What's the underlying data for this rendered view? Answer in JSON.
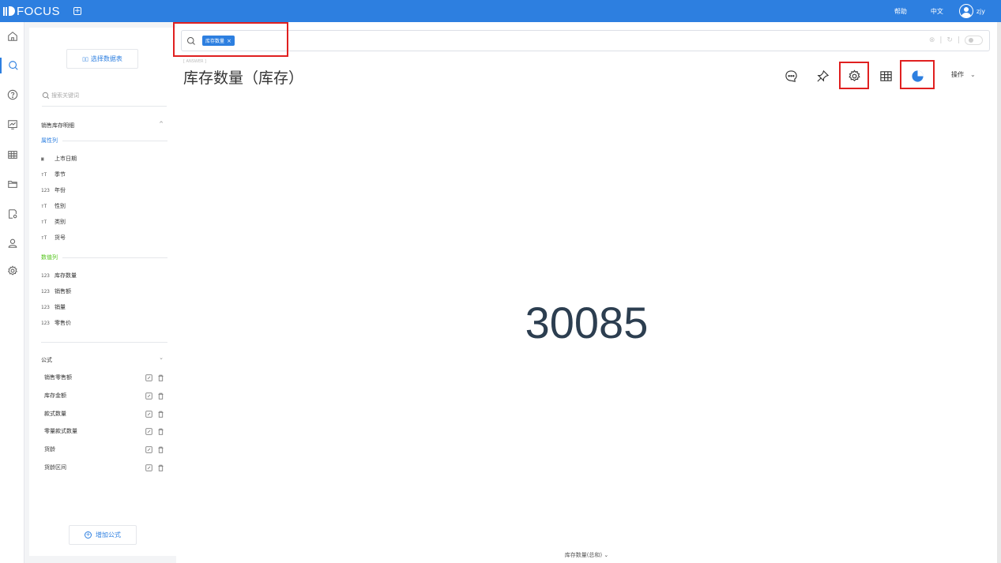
{
  "app": {
    "logo_text": "FOCUS",
    "new_tab_icon": "plus-square-icon"
  },
  "topbar": {
    "help": "帮助",
    "language": "中文",
    "user": "zjy"
  },
  "nav": [
    "home-icon",
    "search-icon",
    "help-icon",
    "dashboard-icon",
    "table-icon",
    "folder-icon",
    "data-settings-icon",
    "user-icon",
    "settings-icon"
  ],
  "sidebar": {
    "choose_table": "选择数据表",
    "search_placeholder": "搜索关键词",
    "table_name": "销售库存明细",
    "attribute_label": "属性列",
    "attribute_columns": [
      {
        "type": "date",
        "name": "上市日期"
      },
      {
        "type": "text",
        "name": "季节"
      },
      {
        "type": "num",
        "name": "年份"
      },
      {
        "type": "text",
        "name": "性别"
      },
      {
        "type": "text",
        "name": "类别"
      },
      {
        "type": "text",
        "name": "货号"
      }
    ],
    "measure_label": "数值列",
    "measure_columns": [
      {
        "type": "123",
        "name": "库存数量"
      },
      {
        "type": "123",
        "name": "销售额"
      },
      {
        "type": "123",
        "name": "销量"
      },
      {
        "type": "123",
        "name": "零售价"
      }
    ],
    "formula_label": "公式",
    "formulas": [
      "销售零售额",
      "库存金额",
      "款式数量",
      "零量款式数量",
      "货龄",
      "货龄区间"
    ],
    "add_formula": "增加公式"
  },
  "search": {
    "chip": "库存数量"
  },
  "answer": {
    "tag": "[ ANSWER ]",
    "title": "库存数量（库存）",
    "value": "30085",
    "footer": "库存数量(总和)",
    "ops_label": "操作"
  },
  "colors": {
    "brand": "#2d7fe0",
    "highlight": "#e02020",
    "measure": "#52c41a"
  }
}
